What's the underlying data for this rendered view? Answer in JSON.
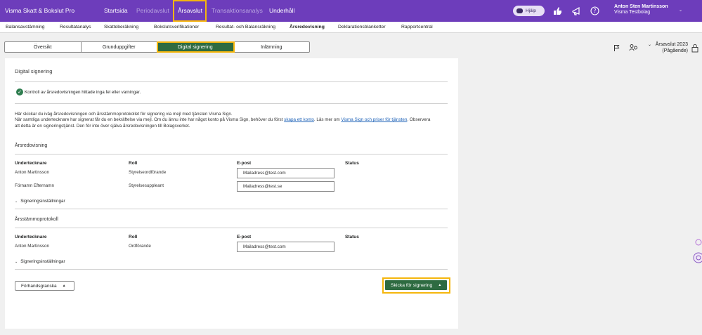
{
  "app": {
    "brand": "Visma Skatt & Bokslut Pro",
    "nav": [
      "Startsida",
      "Periodavslut",
      "Årsavslut",
      "Transaktionsanalys",
      "Underhåll"
    ],
    "help": "Hjälp",
    "user_name": "Anton Sten Martinsson",
    "company": "Visma Testbolag"
  },
  "subnav": [
    "Balansavstämning",
    "Resultatanalys",
    "Skatteberäkning",
    "Bokslutsverifikationer",
    "Resultat- och Balansräkning",
    "Årsredovisning",
    "Deklarationsblanketter",
    "Rapportcentral"
  ],
  "tabs": [
    "Översikt",
    "Grunduppgifter",
    "Digital signering",
    "Inlämning"
  ],
  "year": {
    "label": "Årsavslut 2023",
    "status": "(Pågående)"
  },
  "page": {
    "title": "Digital signering",
    "check_msg": "Kontroll av årsredovisningen hittade inga fel eller varningar.",
    "info_l1": "Här skickar du iväg årsredovisningen och årsstämmoprotokollet för signering via mejl med tjänsten Visma Sign.",
    "info_l2a": "När samtliga undertecknare har signerat får du en bekräftelse via mejl. Om du ännu inte har något konto på Visma Sign, behöver du först ",
    "info_link1": "skapa ett konto",
    "info_l2b": ". Läs mer om ",
    "info_link2": "Visma Sign och priser för tjänsten",
    "info_l3": ". Observera att detta är en signeringstjänst. Den för inte över själva årsredovisningen till Bolagsverket.",
    "col_signer": "Undertecknare",
    "col_role": "Roll",
    "col_email": "E-post",
    "col_status": "Status",
    "sec1": {
      "title": "Årsredovisning",
      "rows": [
        {
          "name": "Anton Martinsson",
          "role": "Styrelseordförande",
          "email": "Mailadress@test.com"
        },
        {
          "name": "Förnamn Efternamn",
          "role": "Styrelsesuppleant",
          "email": "Mailadress@test.se"
        }
      ]
    },
    "sec2": {
      "title": "Årsstämmoprotokoll",
      "rows": [
        {
          "name": "Anton Martinsson",
          "role": "Ordförande",
          "email": "Mailadress@test.com"
        }
      ]
    },
    "sign_settings": "Signeringsinställningar",
    "preview_btn": "Förhandsgranska",
    "send_btn": "Skicka för signering"
  },
  "colors": {
    "purple": "#6d3dbb",
    "green": "#2e6b41",
    "highlight": "#f5b60d"
  }
}
